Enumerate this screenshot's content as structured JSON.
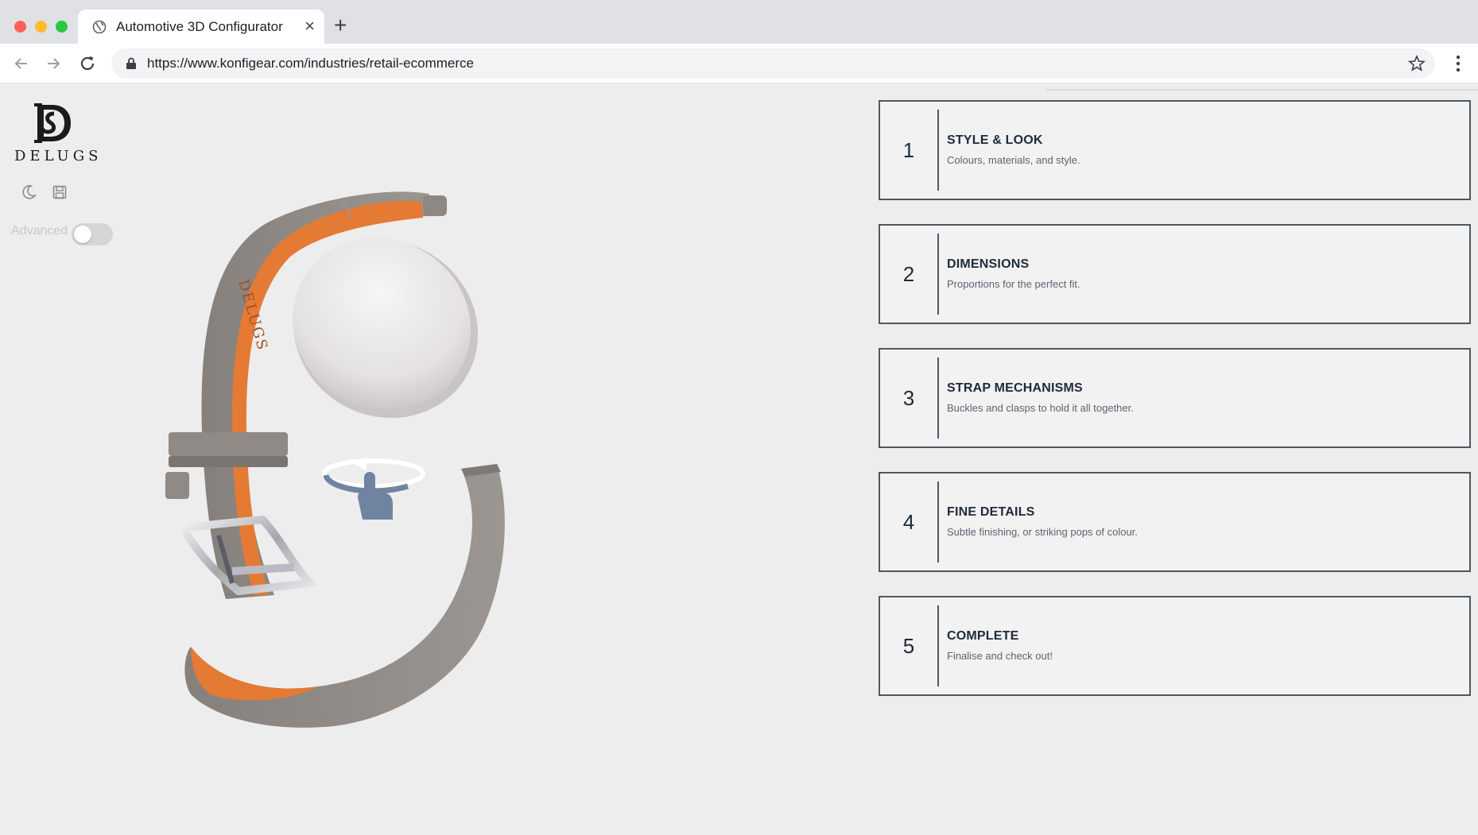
{
  "browser": {
    "tab_title": "Automotive 3D Configurator",
    "url": "https://www.konfigear.com/industries/retail-ecommerce"
  },
  "brand": {
    "logo_text": "DELUGS",
    "strap_stamp": "DELUGS"
  },
  "sidebar": {
    "advanced_label": "Advanced",
    "advanced_on": false
  },
  "steps": [
    {
      "number": "1",
      "title": "STYLE & LOOK",
      "description": "Colours, materials, and style."
    },
    {
      "number": "2",
      "title": "DIMENSIONS",
      "description": "Proportions for the perfect fit."
    },
    {
      "number": "3",
      "title": "STRAP MECHANISMS",
      "description": "Buckles and clasps to hold it all together."
    },
    {
      "number": "4",
      "title": "FINE DETAILS",
      "description": "Subtle finishing, or striking pops of colour."
    },
    {
      "number": "5",
      "title": "COMPLETE",
      "description": "Finalise and check out!"
    }
  ],
  "colors": {
    "strap_outer": "#8f8a86",
    "strap_inner": "#e57a35",
    "step_border": "#4e5763",
    "rotate_hint": "#6f84a0"
  },
  "icons": [
    "globe-icon",
    "close-icon",
    "plus-icon",
    "back-arrow-icon",
    "forward-arrow-icon",
    "reload-icon",
    "lock-icon",
    "star-icon",
    "more-vert-icon",
    "moon-icon",
    "save-icon",
    "rotate-hand-icon"
  ]
}
